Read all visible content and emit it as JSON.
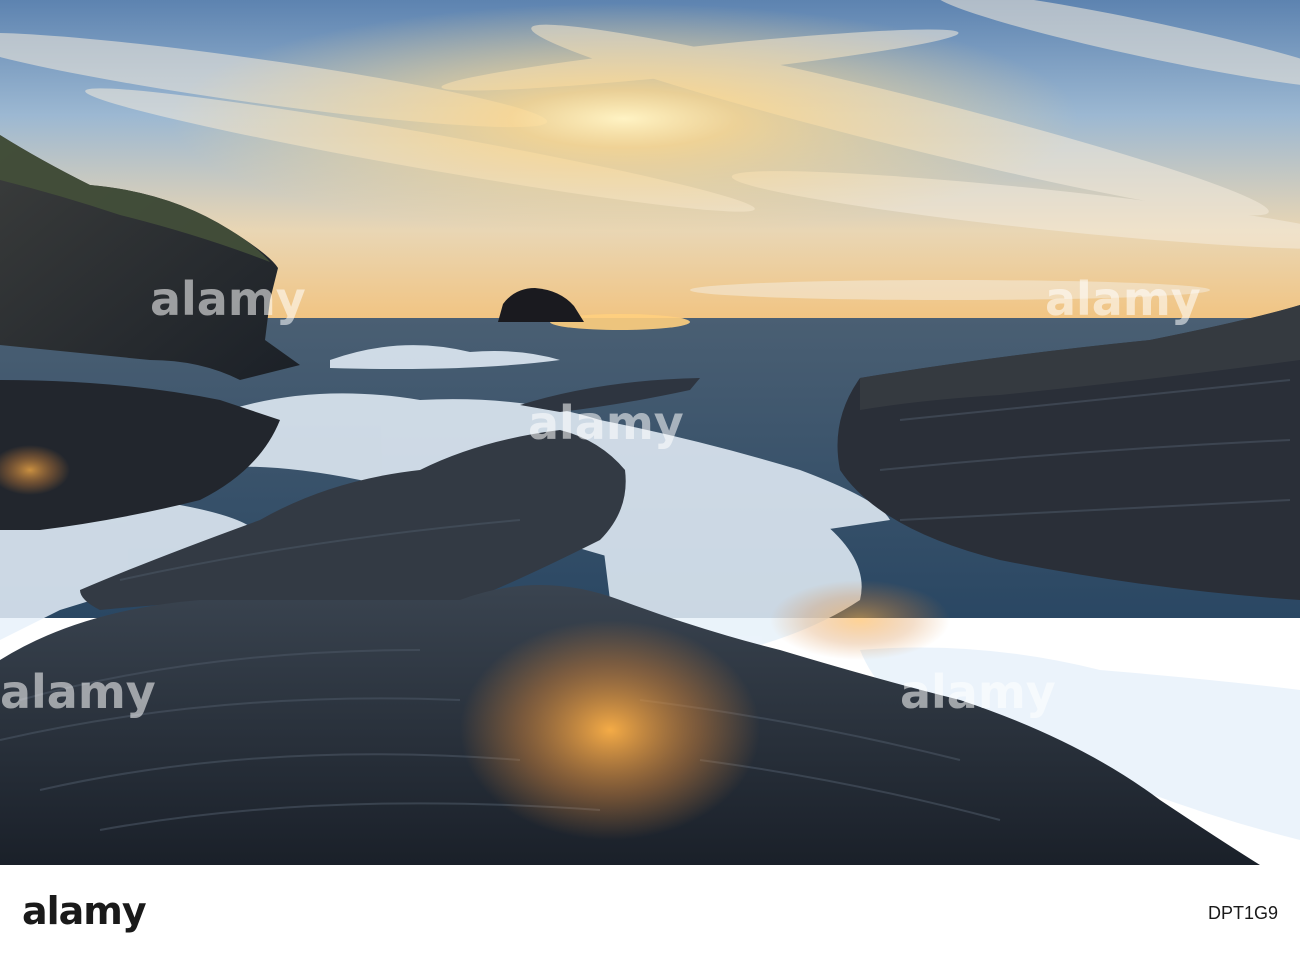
{
  "watermark": {
    "text": "alamy"
  },
  "footer": {
    "logo": "alamy",
    "image_id": "DPT1G9"
  },
  "colors": {
    "sky_top": "#5f86b3",
    "sun": "#ffd07a",
    "sea": "#2c4a6a",
    "rock": "#26303d",
    "foam": "#eaf3fb"
  }
}
